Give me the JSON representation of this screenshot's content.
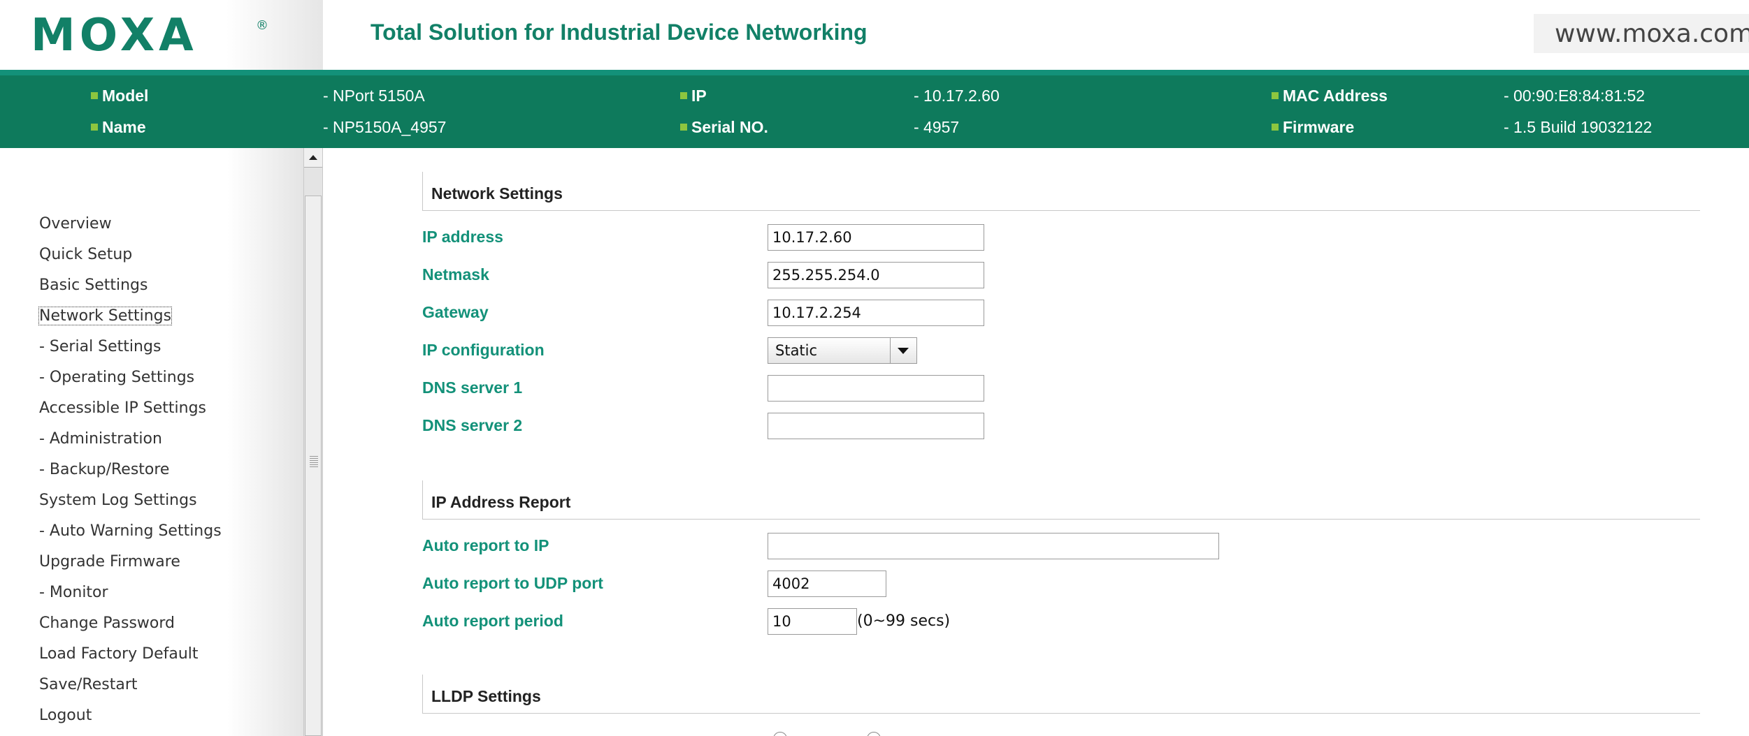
{
  "header": {
    "logo": "MOXA",
    "registered_mark": "®",
    "tagline": "Total Solution for Industrial Device Networking",
    "site_url": "www.moxa.com"
  },
  "device_info": {
    "model_label": "Model",
    "model_value": "- NPort 5150A",
    "name_label": "Name",
    "name_value": "- NP5150A_4957",
    "ip_label": "IP",
    "ip_value": "- 10.17.2.60",
    "serial_label": "Serial NO.",
    "serial_value": "- 4957",
    "mac_label": "MAC Address",
    "mac_value": "- 00:90:E8:84:81:52",
    "firmware_label": "Firmware",
    "firmware_value": "- 1.5 Build 19032122"
  },
  "sidebar": {
    "items": [
      {
        "label": "Overview"
      },
      {
        "label": "Quick Setup"
      },
      {
        "label": "Basic Settings"
      },
      {
        "label": "Network Settings"
      },
      {
        "label": "- Serial Settings"
      },
      {
        "label": "- Operating Settings"
      },
      {
        "label": "Accessible IP Settings"
      },
      {
        "label": "- Administration"
      },
      {
        "label": "- Backup/Restore"
      },
      {
        "label": "System Log Settings"
      },
      {
        "label": "- Auto Warning Settings"
      },
      {
        "label": "Upgrade Firmware"
      },
      {
        "label": "- Monitor"
      },
      {
        "label": "Change Password"
      },
      {
        "label": "Load Factory Default"
      },
      {
        "label": "Save/Restart"
      },
      {
        "label": "Logout"
      }
    ]
  },
  "network_settings": {
    "title": "Network Settings",
    "ip_address_label": "IP address",
    "ip_address_value": "10.17.2.60",
    "netmask_label": "Netmask",
    "netmask_value": "255.255.254.0",
    "gateway_label": "Gateway",
    "gateway_value": "10.17.2.254",
    "ip_config_label": "IP configuration",
    "ip_config_value": "Static",
    "dns1_label": "DNS server 1",
    "dns1_value": "",
    "dns2_label": "DNS server 2",
    "dns2_value": ""
  },
  "ip_report": {
    "title": "IP Address Report",
    "auto_ip_label": "Auto report to IP",
    "auto_ip_value": "",
    "udp_port_label": "Auto report to UDP port",
    "udp_port_value": "4002",
    "period_label": "Auto report period",
    "period_value": "10",
    "period_suffix": "(0~99 secs)"
  },
  "lldp": {
    "title": "LLDP Settings"
  }
}
